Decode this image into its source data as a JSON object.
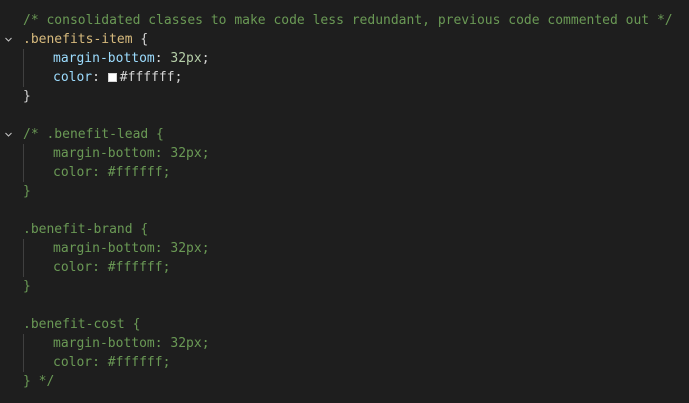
{
  "colors": {
    "background": "#1e1e1e",
    "comment": "#6a9955",
    "selector": "#d7ba7d",
    "property": "#9cdcfe",
    "number": "#b5cea8",
    "punctuation": "#d4d4d4",
    "swatch": "#ffffff"
  },
  "lines": {
    "l1": "/* consolidated classes to make code less redundant, previous code commented out */",
    "l2_selector": ".benefits-item",
    "l2_brace": " {",
    "l3_prop": "margin-bottom",
    "l3_colon": ": ",
    "l3_value": "32px",
    "l3_semi": ";",
    "l4_prop": "color",
    "l4_colon": ": ",
    "l4_value": "#ffffff",
    "l4_semi": ";",
    "l5": "}",
    "l7": "/* .benefit-lead {",
    "l8": "margin-bottom: 32px;",
    "l9": "color: #ffffff;",
    "l10": "}",
    "l12": ".benefit-brand {",
    "l13": "margin-bottom: 32px;",
    "l14": "color: #ffffff;",
    "l15": "}",
    "l17": ".benefit-cost {",
    "l18": "margin-bottom: 32px;",
    "l19": "color: #ffffff;",
    "l20": "} */"
  }
}
